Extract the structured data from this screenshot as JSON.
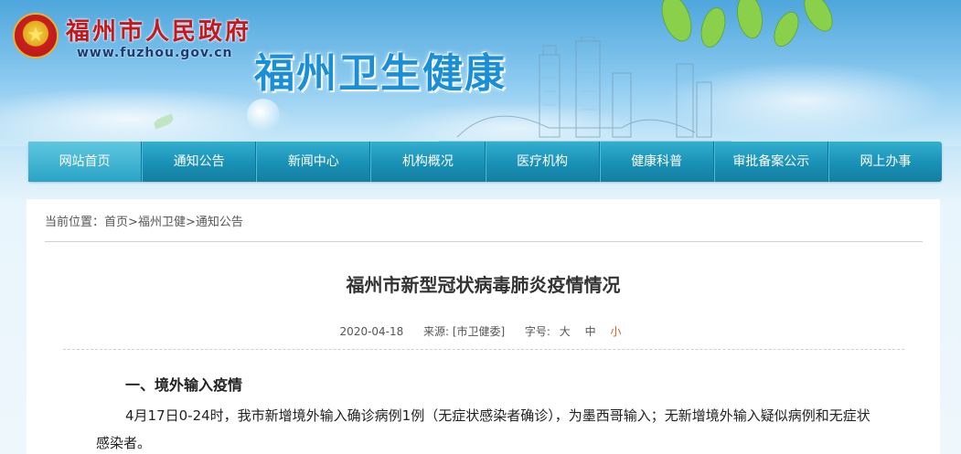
{
  "header": {
    "gov_name": "福州市人民政府",
    "gov_url": "www.fuzhou.gov.cn",
    "site_title": "福州卫生健康"
  },
  "nav": {
    "items": [
      {
        "label": "网站首页"
      },
      {
        "label": "通知公告"
      },
      {
        "label": "新闻中心"
      },
      {
        "label": "机构概况"
      },
      {
        "label": "医疗机构"
      },
      {
        "label": "健康科普"
      },
      {
        "label": "审批备案公示"
      },
      {
        "label": "网上办事"
      }
    ]
  },
  "breadcrumb": {
    "prefix": "当前位置：",
    "items": [
      "首页",
      "福州卫健",
      "通知公告"
    ],
    "separator": ">"
  },
  "article": {
    "title": "福州市新型冠状病毒肺炎疫情情况",
    "date": "2020-04-18",
    "source_label": "来源:",
    "source": "[市卫健委]",
    "font_size_label": "字号:",
    "font_sizes": [
      "大",
      "中",
      "小"
    ],
    "section_heading": "一、境外输入疫情",
    "paragraph": "4月17日0-24时，我市新增境外输入确诊病例1例（无症状感染者确诊），为墨西哥输入；无新增境外输入疑似病例和无症状感染者。"
  },
  "colors": {
    "nav_bg": "#1990b5",
    "title_blue": "#1a8fd8",
    "gov_red": "#c3181e",
    "active_size": "#e0581e"
  }
}
